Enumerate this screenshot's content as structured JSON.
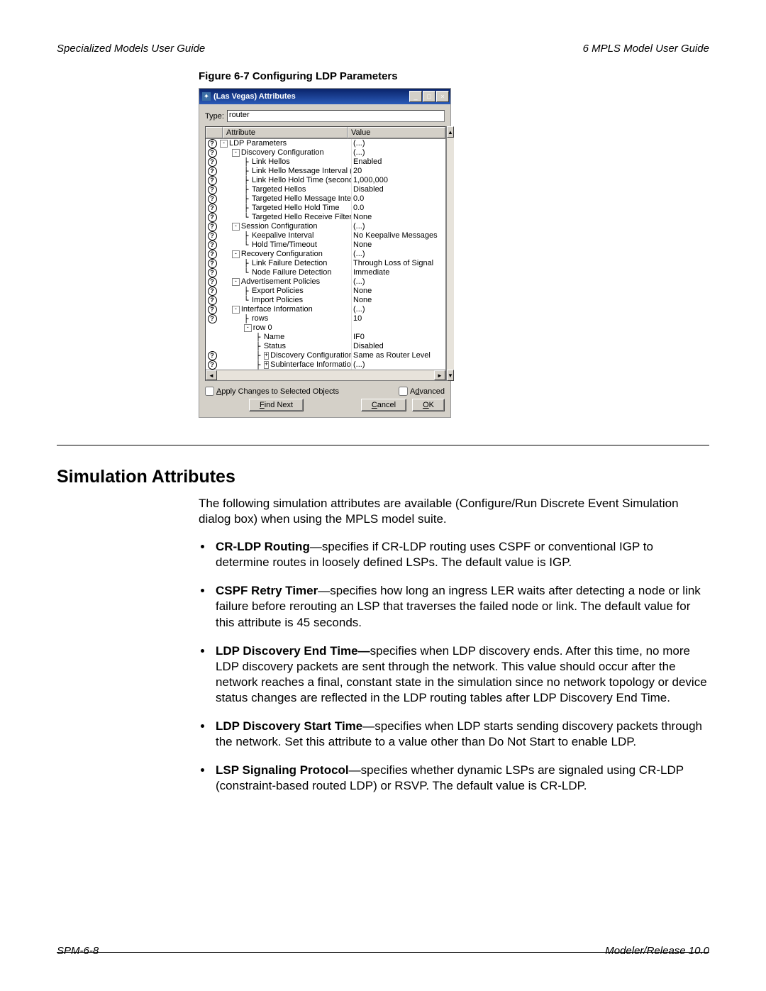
{
  "header": {
    "left": "Specialized Models User Guide",
    "right": "6   MPLS Model User Guide"
  },
  "figure_caption": "Figure 6-7   Configuring LDP Parameters",
  "dialog": {
    "title": "(Las Vegas) Attributes",
    "type_label": "Type:",
    "type_value": "router",
    "columns": {
      "attr": "Attribute",
      "val": "Value"
    },
    "rows": [
      {
        "help": true,
        "indent": 0,
        "expander": "-",
        "label": "LDP Parameters",
        "value": "(...)"
      },
      {
        "help": true,
        "indent": 1,
        "expander": "-",
        "label": "Discovery Configuration",
        "value": "(...)"
      },
      {
        "help": true,
        "indent": 2,
        "tree": "├",
        "label": "Link Hellos",
        "value": "Enabled"
      },
      {
        "help": true,
        "indent": 2,
        "tree": "├",
        "label": "Link Hello Message Interval (seco...",
        "value": "20"
      },
      {
        "help": true,
        "indent": 2,
        "tree": "├",
        "label": "Link Hello Hold Time (seconds)",
        "value": "1,000,000"
      },
      {
        "help": true,
        "indent": 2,
        "tree": "├",
        "label": "Targeted Hellos",
        "value": "Disabled"
      },
      {
        "help": true,
        "indent": 2,
        "tree": "├",
        "label": "Targeted Hello Message Interval",
        "value": "0.0"
      },
      {
        "help": true,
        "indent": 2,
        "tree": "├",
        "label": "Targeted Hello Hold Time",
        "value": "0.0"
      },
      {
        "help": true,
        "indent": 2,
        "tree": "└",
        "label": "Targeted Hello Receive Filters",
        "value": "None"
      },
      {
        "help": true,
        "indent": 1,
        "expander": "-",
        "label": "Session Configuration",
        "value": "(...)"
      },
      {
        "help": true,
        "indent": 2,
        "tree": "├",
        "label": "Keepalive Interval",
        "value": "No Keepalive Messages"
      },
      {
        "help": true,
        "indent": 2,
        "tree": "└",
        "label": "Hold Time/Timeout",
        "value": "None"
      },
      {
        "help": true,
        "indent": 1,
        "expander": "-",
        "label": "Recovery Configuration",
        "value": "(...)"
      },
      {
        "help": true,
        "indent": 2,
        "tree": "├",
        "label": "Link Failure Detection",
        "value": "Through Loss of Signal"
      },
      {
        "help": true,
        "indent": 2,
        "tree": "└",
        "label": "Node Failure Detection",
        "value": "Immediate"
      },
      {
        "help": true,
        "indent": 1,
        "expander": "-",
        "label": "Advertisement Policies",
        "value": "(...)"
      },
      {
        "help": true,
        "indent": 2,
        "tree": "├",
        "label": "Export Policies",
        "value": "None"
      },
      {
        "help": true,
        "indent": 2,
        "tree": "└",
        "label": "Import Policies",
        "value": "None"
      },
      {
        "help": true,
        "indent": 1,
        "expander": "-",
        "label": "Interface Information",
        "value": "(...)"
      },
      {
        "help": true,
        "indent": 2,
        "tree": "├",
        "label": "rows",
        "value": "10"
      },
      {
        "help": false,
        "indent": 2,
        "expander": "-",
        "label": "row 0",
        "value": ""
      },
      {
        "help": false,
        "indent": 3,
        "tree": "├",
        "label": "Name",
        "value": "IF0"
      },
      {
        "help": false,
        "indent": 3,
        "tree": "├",
        "label": "Status",
        "value": "Disabled"
      },
      {
        "help": true,
        "indent": 3,
        "expander": "+",
        "tree": "├",
        "label": "Discovery Configuration",
        "value": "Same as Router Level"
      },
      {
        "help": true,
        "indent": 3,
        "expander": "+",
        "tree": "├",
        "label": "Subinterface Information",
        "value": "(...)"
      }
    ],
    "apply_label": "Apply Changes to Selected Objects",
    "advanced_label": "Advanced",
    "buttons": {
      "find": "Find Next",
      "cancel": "Cancel",
      "ok": "OK"
    }
  },
  "heading": "Simulation Attributes",
  "intro": "The following simulation attributes are available (Configure/Run Discrete Event Simulation dialog box) when using the MPLS model suite.",
  "bullets": [
    {
      "term": "CR-LDP Routing",
      "text": "—specifies if CR-LDP routing uses CSPF or conventional IGP to determine routes in loosely defined LSPs. The default value is IGP."
    },
    {
      "term": "CSPF Retry Timer",
      "text": "—specifies how long an ingress LER waits after detecting a node or link failure before rerouting an LSP that traverses the failed node or link. The default value for this attribute is 45 seconds."
    },
    {
      "term": "LDP Discovery End Time—",
      "text": "specifies when LDP discovery ends. After this time, no more LDP discovery packets are sent through the network. This value should occur after the network reaches a final, constant state in the simulation since no network topology or device status changes are reflected in the LDP routing tables after LDP Discovery End Time."
    },
    {
      "term": "LDP Discovery Start Time",
      "text": "—specifies when LDP starts sending discovery packets through the network. Set this attribute to a value other than Do Not Start to enable LDP."
    },
    {
      "term": "LSP Signaling Protocol",
      "text": "—specifies whether dynamic LSPs are signaled using CR-LDP (constraint-based routed LDP) or RSVP. The default value is CR-LDP."
    }
  ],
  "footer": {
    "left": "SPM-6-8",
    "right": "Modeler/Release 10.0"
  }
}
